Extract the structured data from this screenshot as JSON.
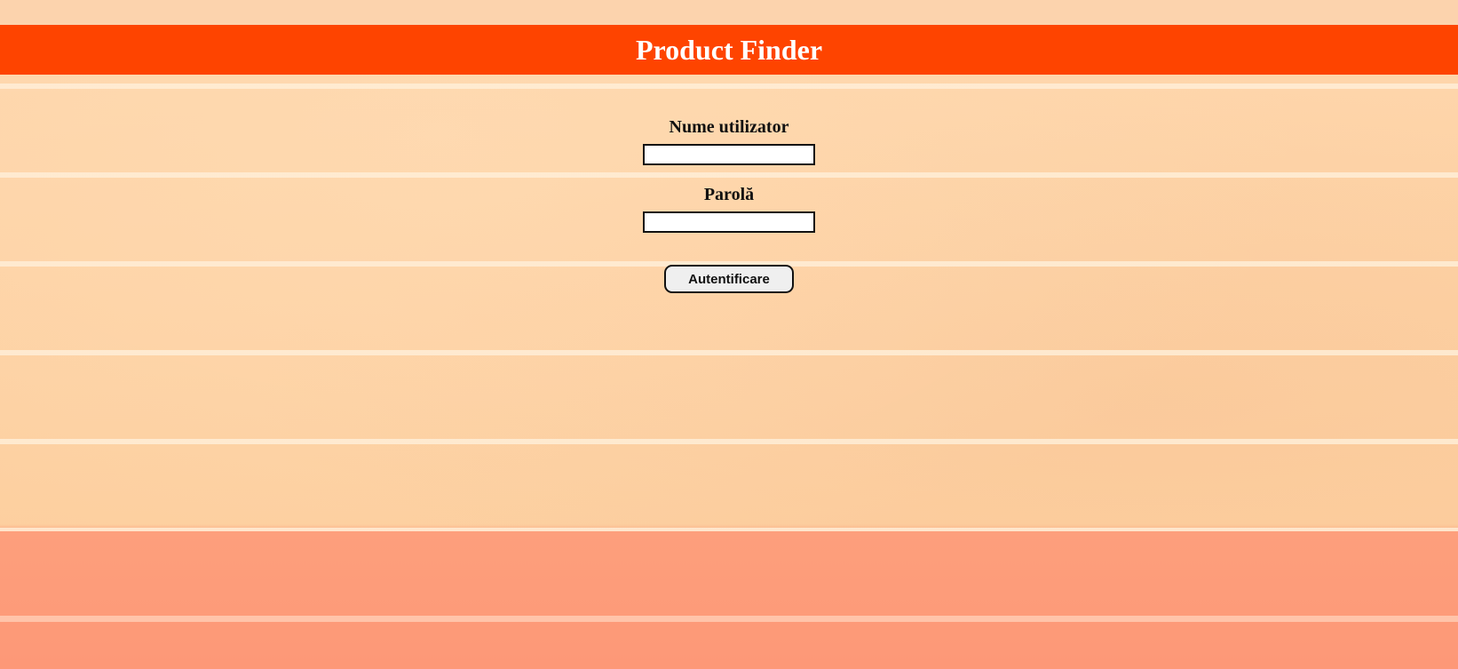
{
  "header": {
    "title": "Product Finder",
    "background_color": "#fe4400",
    "text_color": "#ffffff"
  },
  "login": {
    "username_label": "Nume utilizator",
    "username_value": "",
    "password_label": "Parolă",
    "password_value": "",
    "submit_label": "Autentificare"
  },
  "background": {
    "description_colors": {
      "upper_wall": "#fed2a6",
      "lower_wall": "#fd9c78"
    }
  }
}
